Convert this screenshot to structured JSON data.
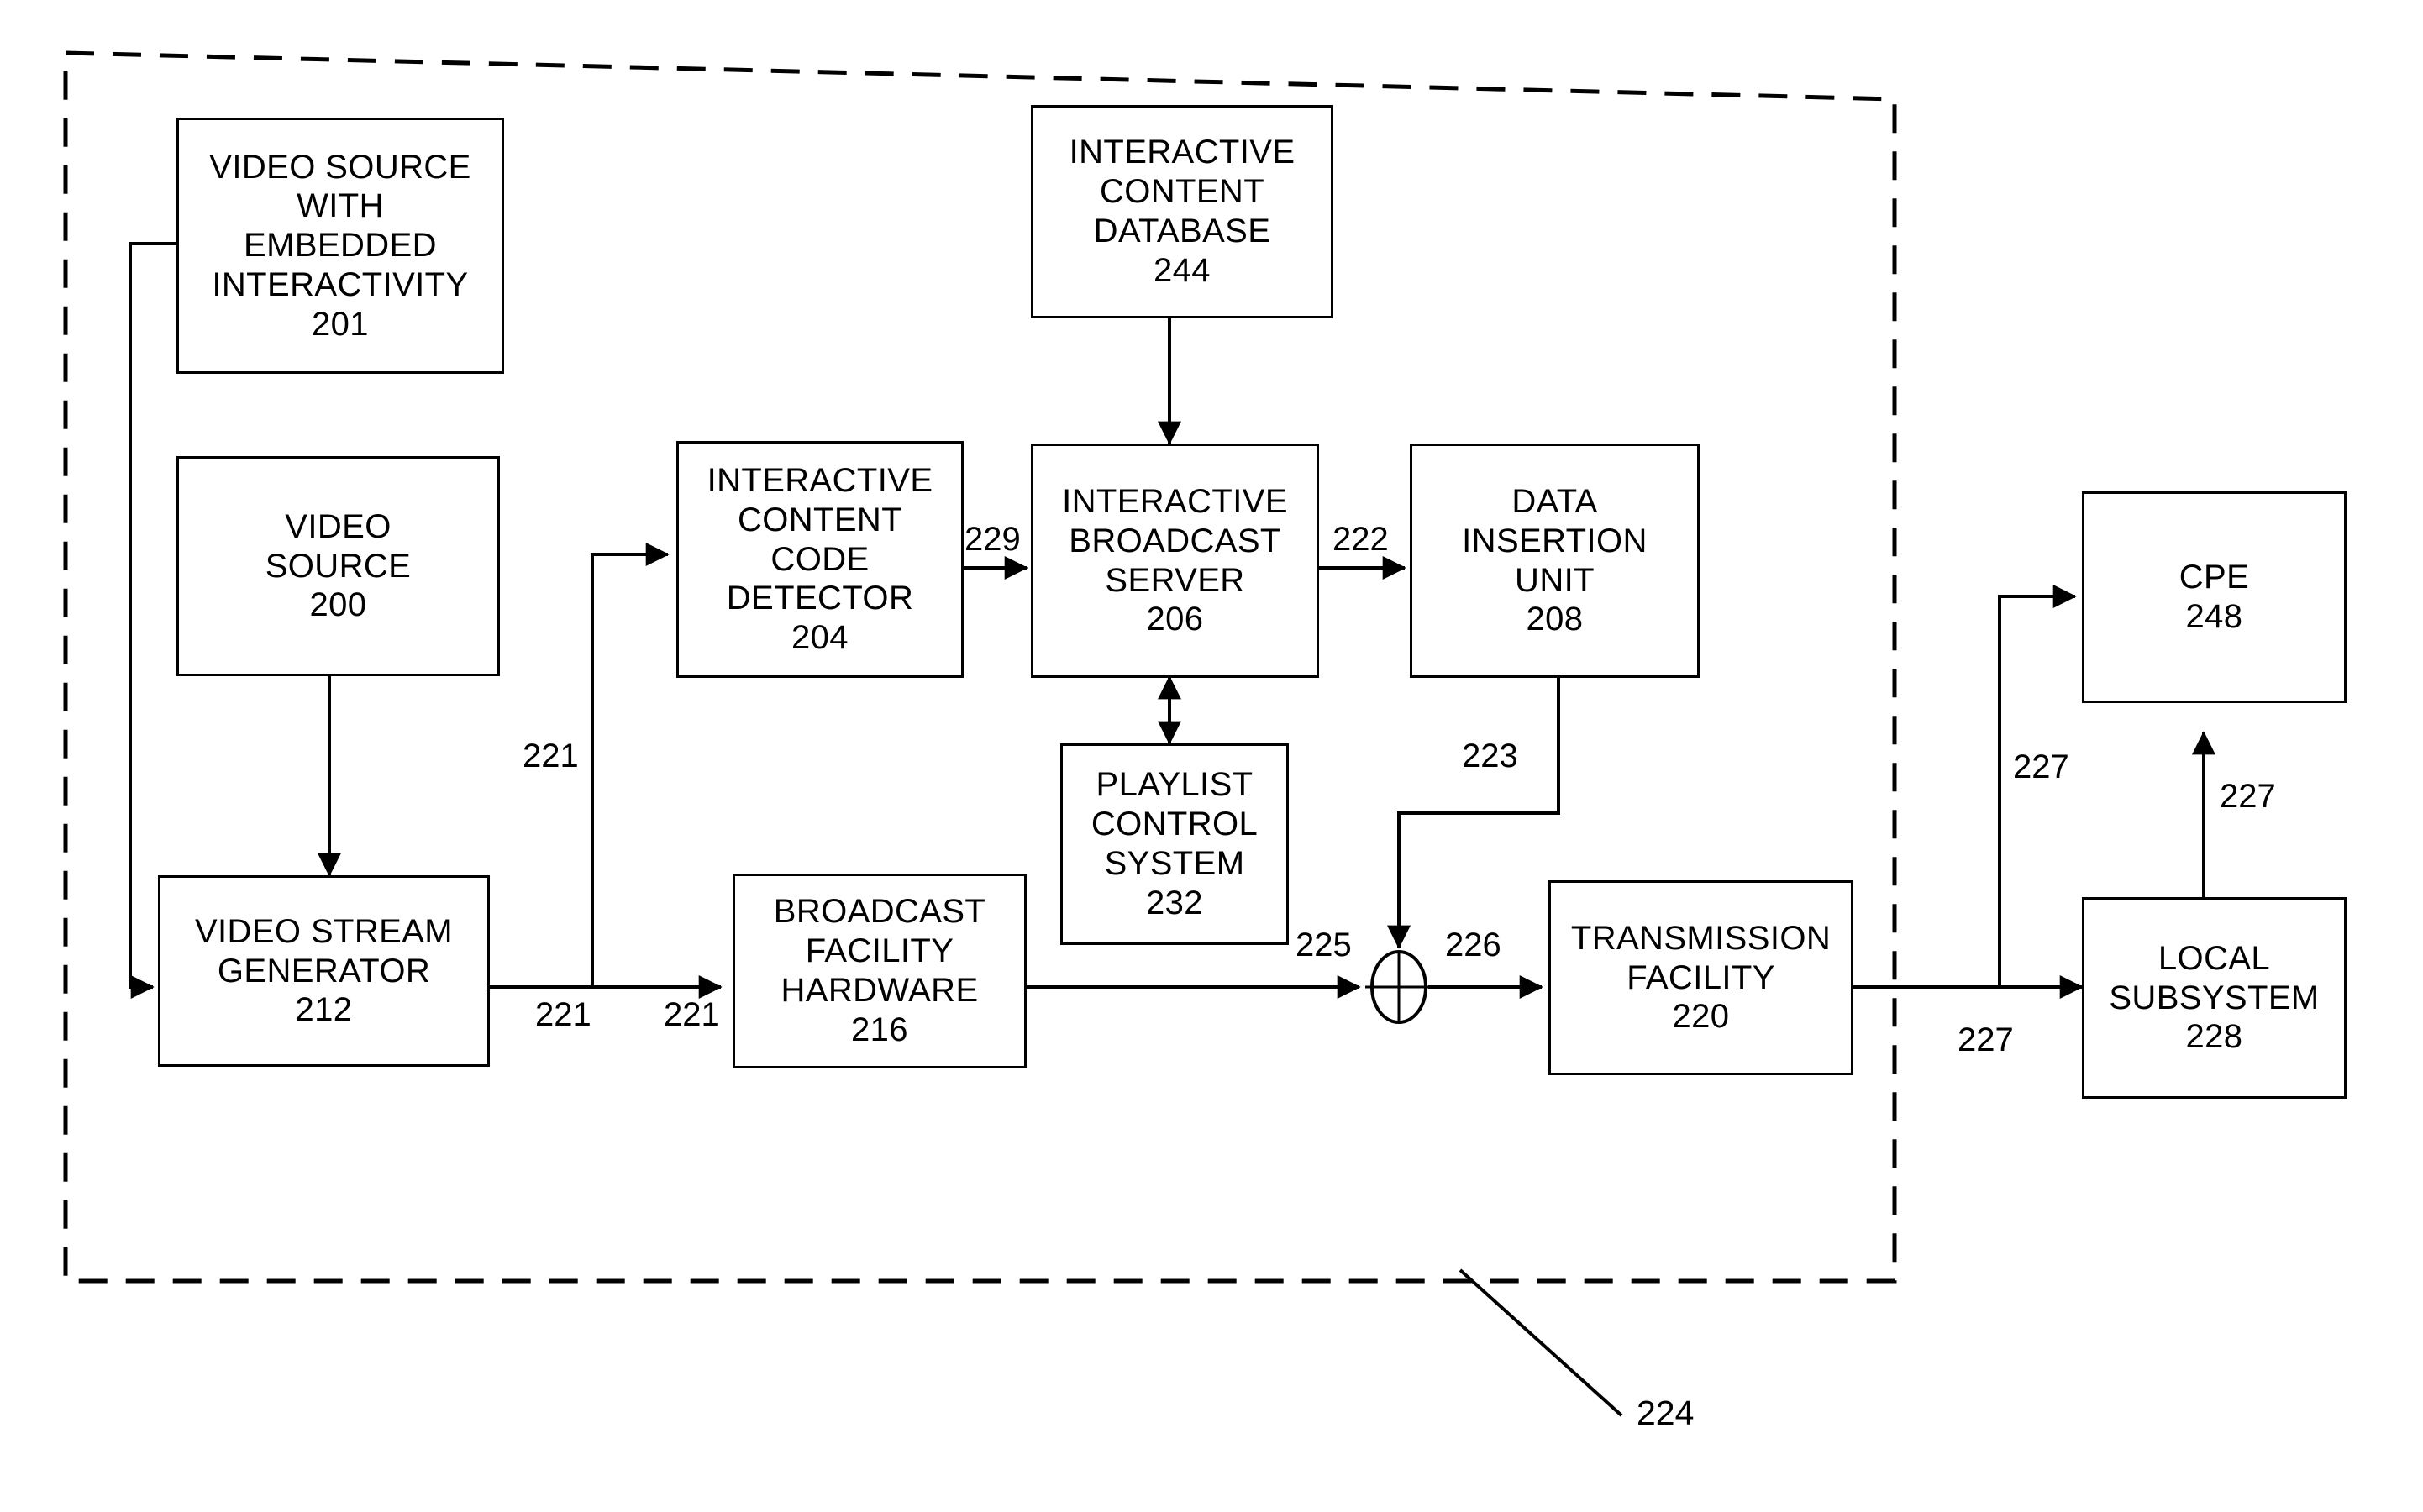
{
  "figure": {
    "title": "Interactive broadcast system block diagram",
    "boundary_ref": "224",
    "stroke_color": "#000000",
    "background_color": "#ffffff"
  },
  "nodes": [
    {
      "id": "video-source-embedded-interactivity",
      "lines": [
        "VIDEO SOURCE",
        "WITH",
        "EMBEDDED",
        "INTERACTIVITY",
        "201"
      ],
      "ref": "201"
    },
    {
      "id": "video-source",
      "lines": [
        "VIDEO",
        "SOURCE",
        "200"
      ],
      "ref": "200"
    },
    {
      "id": "interactive-content-code-detector",
      "lines": [
        "INTERACTIVE",
        "CONTENT",
        "CODE",
        "DETECTOR",
        "204"
      ],
      "ref": "204"
    },
    {
      "id": "interactive-content-database",
      "lines": [
        "INTERACTIVE",
        "CONTENT",
        "DATABASE",
        "244"
      ],
      "ref": "244"
    },
    {
      "id": "interactive-broadcast-server",
      "lines": [
        "INTERACTIVE",
        "BROADCAST",
        "SERVER",
        "206"
      ],
      "ref": "206"
    },
    {
      "id": "data-insertion-unit",
      "lines": [
        "DATA",
        "INSERTION",
        "UNIT",
        "208"
      ],
      "ref": "208"
    },
    {
      "id": "playlist-control-system",
      "lines": [
        "PLAYLIST",
        "CONTROL",
        "SYSTEM",
        "232"
      ],
      "ref": "232"
    },
    {
      "id": "video-stream-generator",
      "lines": [
        "VIDEO STREAM",
        "GENERATOR",
        "212"
      ],
      "ref": "212"
    },
    {
      "id": "broadcast-facility-hardware",
      "lines": [
        "BROADCAST",
        "FACILITY",
        "HARDWARE",
        "216"
      ],
      "ref": "216"
    },
    {
      "id": "transmission-facility",
      "lines": [
        "TRANSMISSION",
        "FACILITY",
        "220"
      ],
      "ref": "220"
    },
    {
      "id": "cpe",
      "lines": [
        "CPE",
        "248"
      ],
      "ref": "248"
    },
    {
      "id": "local-subsystem",
      "lines": [
        "LOCAL",
        "SUBSYSTEM",
        "228"
      ],
      "ref": "228"
    }
  ],
  "edge_labels": [
    {
      "id": "label-229",
      "text": "229"
    },
    {
      "id": "label-222",
      "text": "222"
    },
    {
      "id": "label-223",
      "text": "223"
    },
    {
      "id": "label-221-vertical",
      "text": "221"
    },
    {
      "id": "label-221-left",
      "text": "221"
    },
    {
      "id": "label-221-right",
      "text": "221"
    },
    {
      "id": "label-225",
      "text": "225"
    },
    {
      "id": "label-226",
      "text": "226"
    },
    {
      "id": "label-227-vertical",
      "text": "227"
    },
    {
      "id": "label-227-riser",
      "text": "227"
    },
    {
      "id": "label-227-horizontal",
      "text": "227"
    }
  ],
  "boundary_label": {
    "id": "label-224",
    "text": "224"
  }
}
